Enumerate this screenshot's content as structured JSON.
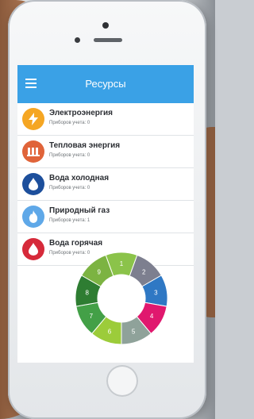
{
  "app": {
    "title": "Ресурсы"
  },
  "colors": {
    "appbar": "#3aa1e6",
    "electricity": "#f5a623",
    "heat": "#e0643a",
    "cold_water": "#1d4f9c",
    "gas": "#5fa8e8",
    "hot_water": "#d62a3a"
  },
  "resources": [
    {
      "name": "Электроэнергия",
      "sub": "Приборов учета: 0",
      "icon": "lightning-icon"
    },
    {
      "name": "Тепловая энергия",
      "sub": "Приборов учета: 0",
      "icon": "radiator-icon"
    },
    {
      "name": "Вода холодная",
      "sub": "Приборов учета: 0",
      "icon": "water-drop-icon"
    },
    {
      "name": "Природный газ",
      "sub": "Приборов учета: 1",
      "icon": "flame-icon"
    },
    {
      "name": "Вода горячая",
      "sub": "Приборов учета: 0",
      "icon": "hot-water-drop-icon"
    }
  ],
  "chart_data": {
    "type": "pie",
    "donut": true,
    "categories": [
      "1",
      "2",
      "3",
      "4",
      "5",
      "6",
      "7",
      "8",
      "9"
    ],
    "values": [
      1,
      1,
      1,
      1,
      1,
      1,
      1,
      1,
      1
    ],
    "colors": [
      "#8bc34a",
      "#7d7f8f",
      "#2f78c4",
      "#e0186e",
      "#8fa29a",
      "#9ccc3a",
      "#43a047",
      "#2e7d32",
      "#7cb342"
    ]
  }
}
